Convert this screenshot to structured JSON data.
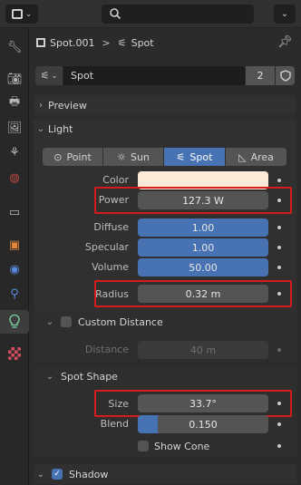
{
  "header": {
    "editor_icon": "properties-editor-icon",
    "search_placeholder": "",
    "close_glyph": "✕"
  },
  "breadcrumb": {
    "object": "Spot.001",
    "separator": ">",
    "data": "Spot"
  },
  "datablock": {
    "name": "Spot",
    "users": "2"
  },
  "panels": {
    "preview": "Preview",
    "light": "Light",
    "custom_distance": "Custom Distance",
    "spot_shape": "Spot Shape",
    "shadow": "Shadow"
  },
  "light_types": [
    "Point",
    "Sun",
    "Spot",
    "Area"
  ],
  "light_type_selected": "Spot",
  "props": {
    "color_label": "Color",
    "color_value": "#fdebd7",
    "power_label": "Power",
    "power_value": "127.3 W",
    "diffuse_label": "Diffuse",
    "diffuse_value": "1.00",
    "specular_label": "Specular",
    "specular_value": "1.00",
    "volume_label": "Volume",
    "volume_value": "50.00",
    "radius_label": "Radius",
    "radius_value": "0.32 m",
    "distance_label": "Distance",
    "distance_value": "40 m",
    "size_label": "Size",
    "size_value": "33.7°",
    "blend_label": "Blend",
    "blend_value": "0.150",
    "blend_fraction": 0.15,
    "show_cone_label": "Show Cone"
  },
  "colors": {
    "accent_blue": "#4772b3",
    "highlight_red": "#d51c1c",
    "light_icon_green": "#6fc28f"
  }
}
